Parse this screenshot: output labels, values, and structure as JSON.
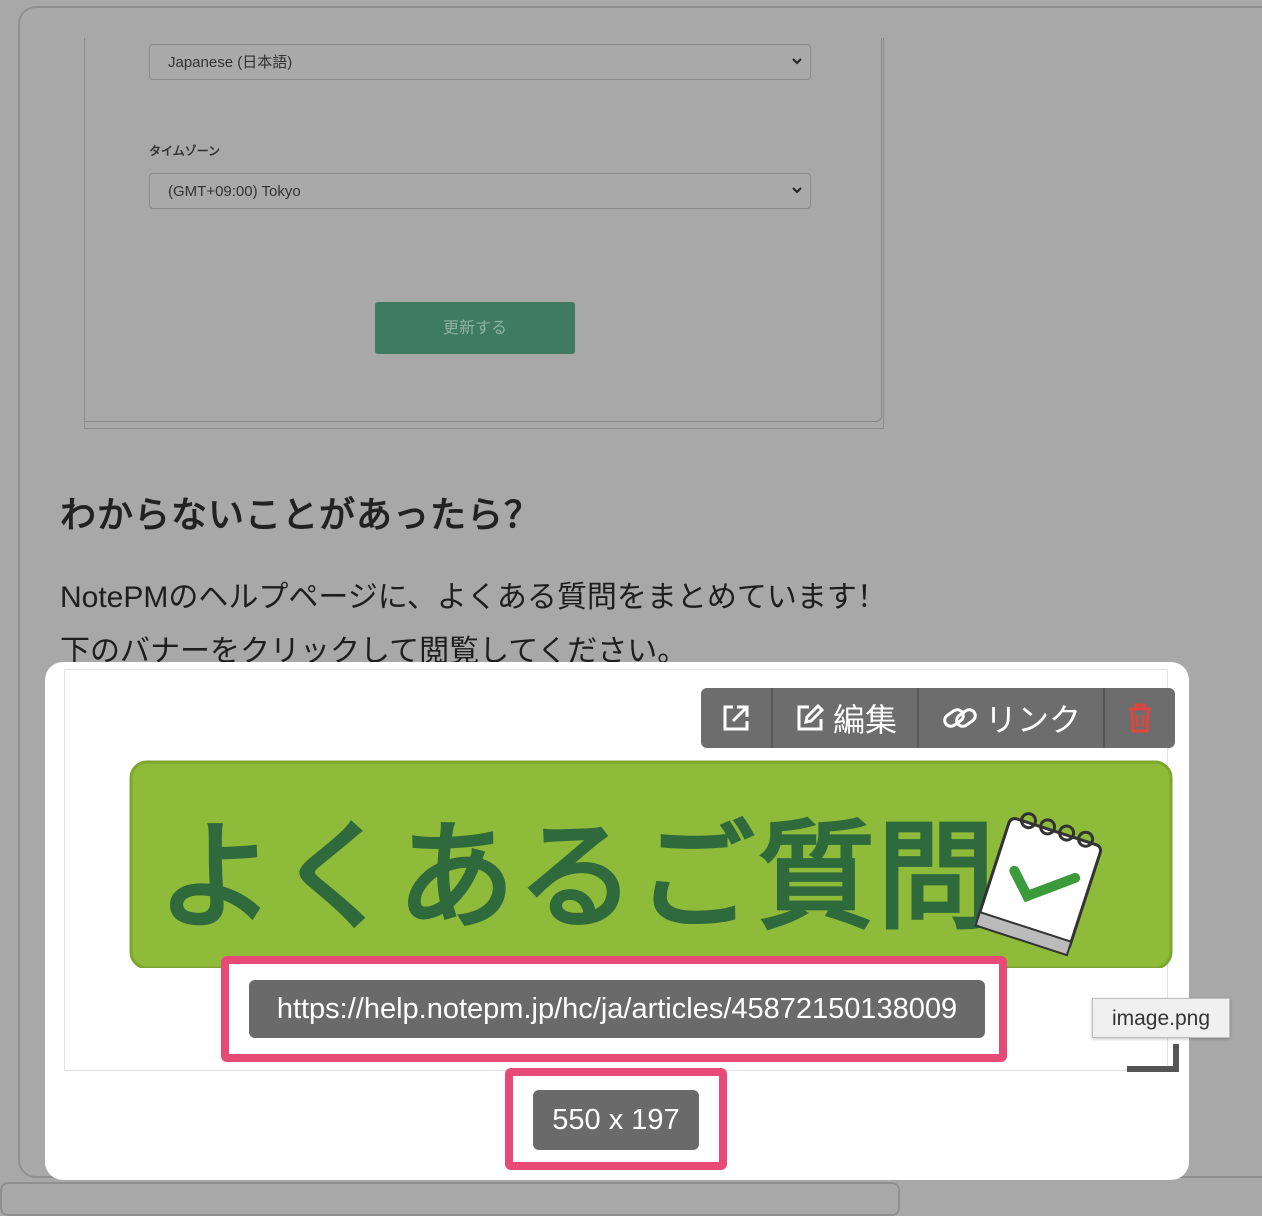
{
  "settings": {
    "language_value": "Japanese (日本語)",
    "timezone_label": "タイムゾーン",
    "timezone_value": "(GMT+09:00) Tokyo",
    "update_button": "更新する"
  },
  "content": {
    "heading": "わからないことがあったら？",
    "para_line1": "NotePMのヘルプページに、よくある質問をまとめています！",
    "para_line2": "下のバナーをクリックして閲覧してください。"
  },
  "image_toolbar": {
    "open_icon": "external-link-icon",
    "edit_label": "編集",
    "edit_icon": "edit-icon",
    "link_label": "リンク",
    "link_icon": "link-icon",
    "delete_icon": "trash-icon"
  },
  "banner": {
    "text": "よくあるご質問",
    "icon": "notepad-check-icon",
    "colors": {
      "background": "#8fbb3a",
      "text": "#2f6a3c"
    }
  },
  "image_info": {
    "url": "https://help.notepm.jp/hc/ja/articles/45872150138009",
    "size": "550 x 197",
    "tooltip": "image.png"
  },
  "colors": {
    "highlight": "#e84a78",
    "button_green": "#3f7a63",
    "overlay": "#a8a8a8"
  }
}
